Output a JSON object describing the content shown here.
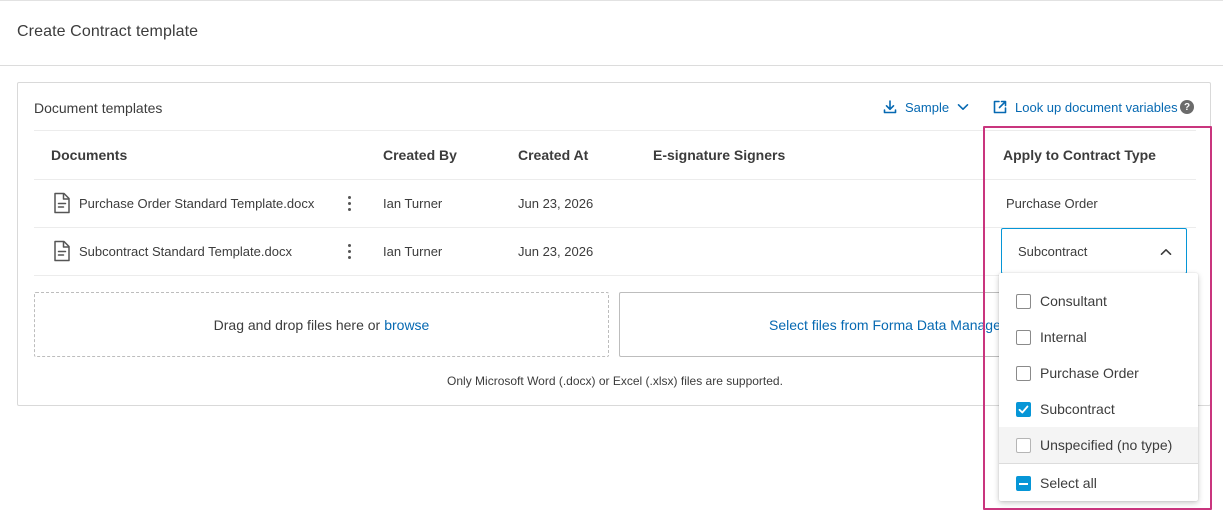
{
  "page": {
    "title": "Create Contract template"
  },
  "card": {
    "title": "Document templates",
    "sample_label": "Sample",
    "lookup_label": "Look up document variables"
  },
  "table": {
    "columns": [
      "Documents",
      "Created By",
      "Created At",
      "E-signature Signers",
      "Apply to Contract Type"
    ],
    "rows": [
      {
        "document": "Purchase Order Standard Template.docx",
        "created_by": "Ian Turner",
        "created_at": "Jun 23, 2026",
        "signers": "",
        "contract_type": "Purchase Order"
      },
      {
        "document": "Subcontract Standard Template.docx",
        "created_by": "Ian Turner",
        "created_at": "Jun 23, 2026",
        "signers": "",
        "contract_type": "Subcontract"
      }
    ]
  },
  "upload": {
    "drop_text": "Drag and drop files here or",
    "browse_label": "browse",
    "forma_label": "Select files from Forma Data Management",
    "support_text": "Only Microsoft Word (.docx) or Excel (.xlsx) files are supported."
  },
  "dropdown": {
    "selected": "Subcontract",
    "options": [
      {
        "label": "Consultant",
        "checked": false
      },
      {
        "label": "Internal",
        "checked": false
      },
      {
        "label": "Purchase Order",
        "checked": false
      },
      {
        "label": "Subcontract",
        "checked": true
      },
      {
        "label": "Unspecified (no type)",
        "checked": false
      }
    ],
    "select_all_label": "Select all",
    "select_all_state": "indeterminate"
  },
  "colors": {
    "accent": "#0696d7",
    "link": "#0669b2",
    "highlight": "#c9357e"
  },
  "icons": {
    "sample": "download-icon",
    "lookup": "external-link-icon",
    "help": "help-icon",
    "document": "document-icon",
    "more": "kebab-menu-icon"
  }
}
